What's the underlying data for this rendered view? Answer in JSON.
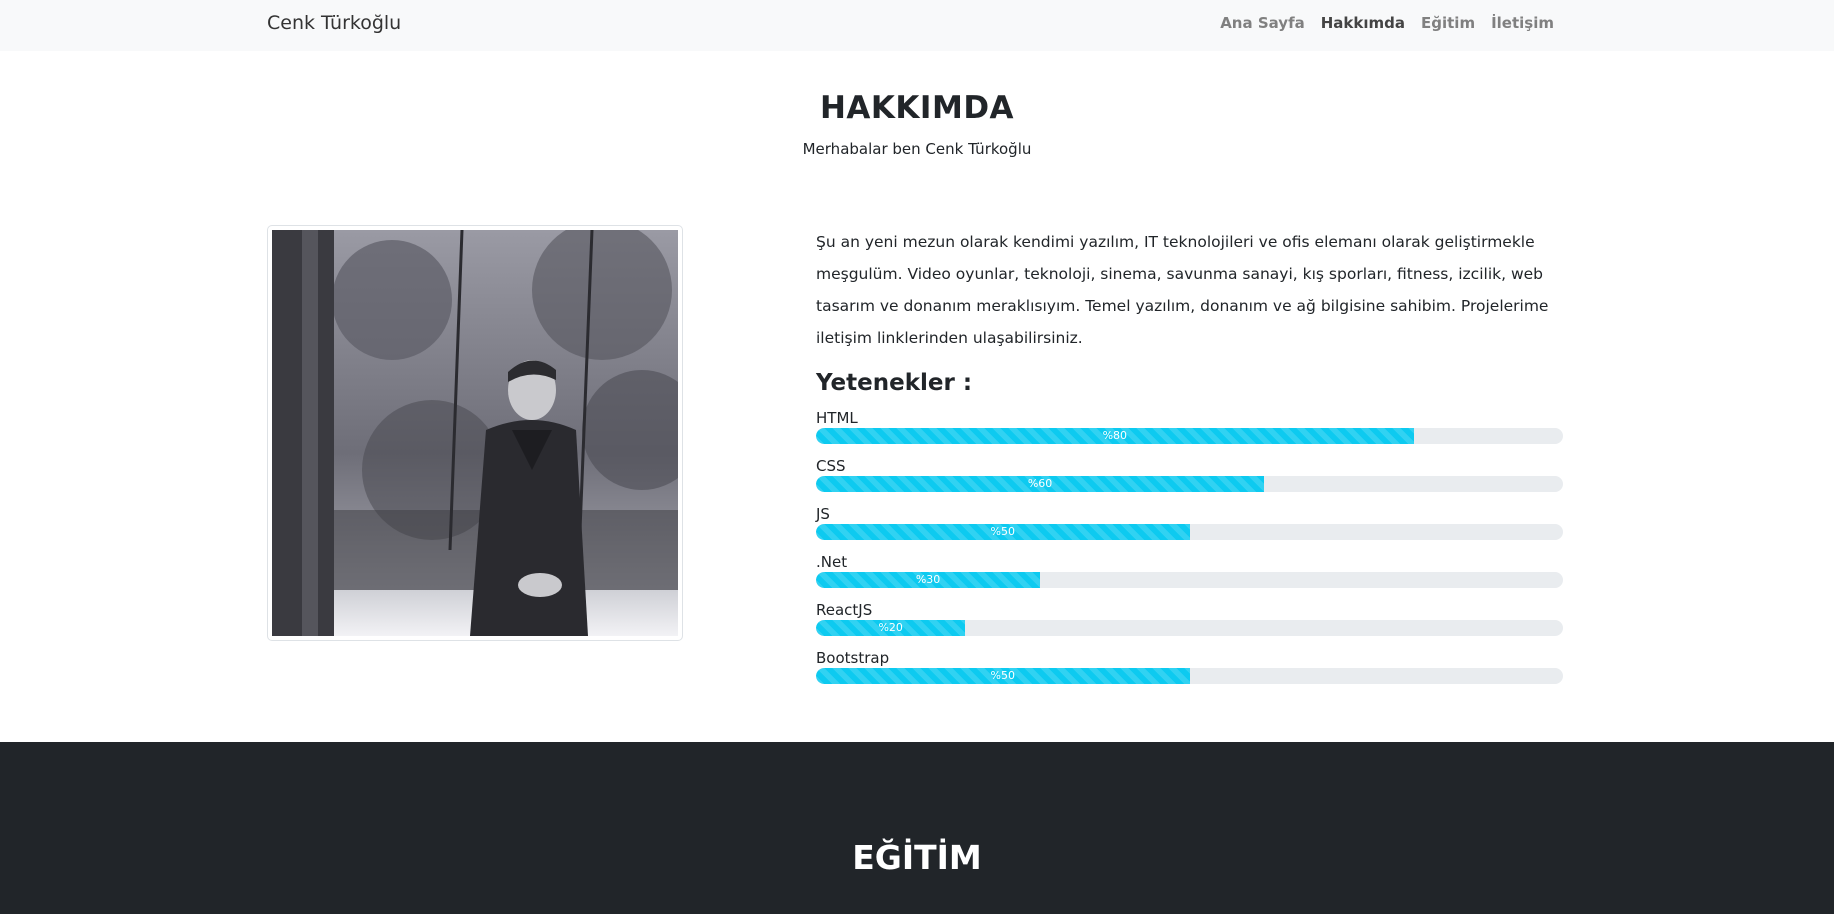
{
  "nav": {
    "brand": "Cenk Türkoğlu",
    "links": [
      {
        "label": "Ana Sayfa"
      },
      {
        "label": "Hakkımda"
      },
      {
        "label": "Eğitim"
      },
      {
        "label": "İletişim"
      }
    ],
    "active": "Hakkımda"
  },
  "about": {
    "title": "HAKKIMDA",
    "subtitle": "Merhabalar ben Cenk Türkoğlu",
    "bio": "Şu an yeni mezun olarak kendimi yazılım, IT teknolojileri ve ofis elemanı olarak geliştirmekle meşgulüm. Video oyunlar, teknoloji, sinema, savunma sanayi, kış sporları, fitness, izcilik, web tasarım ve donanım meraklısıyım. Temel yazılım, donanım ve ağ bilgisine sahibim. Projelerime iletişim linklerinden ulaşabilirsiniz."
  },
  "skills": {
    "title": "Yetenekler :",
    "items": [
      {
        "name": "HTML",
        "percent": 80,
        "label": "%80"
      },
      {
        "name": "CSS",
        "percent": 60,
        "label": "%60"
      },
      {
        "name": "JS",
        "percent": 50,
        "label": "%50"
      },
      {
        "name": ".Net",
        "percent": 30,
        "label": "%30"
      },
      {
        "name": "ReactJS",
        "percent": 20,
        "label": "%20"
      },
      {
        "name": "Bootstrap",
        "percent": 50,
        "label": "%50"
      }
    ],
    "bar_color": "#0dcaf0"
  },
  "education": {
    "title": "EĞİTİM"
  },
  "colors": {
    "navbar_bg": "#f8f9fa",
    "dark_section_bg": "#212529"
  }
}
